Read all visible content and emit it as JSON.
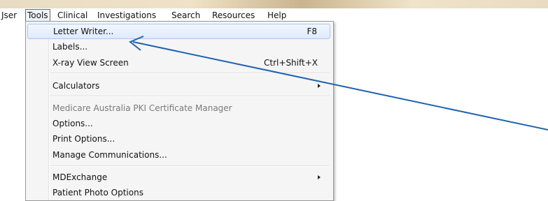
{
  "menubar": {
    "items": [
      {
        "label": "Jser"
      },
      {
        "label": "Tools"
      },
      {
        "label": "Clinical"
      },
      {
        "label": "Investigations"
      },
      {
        "label": "Search"
      },
      {
        "label": "Resources"
      },
      {
        "label": "Help"
      }
    ]
  },
  "tools_menu": {
    "items": [
      {
        "label": "Letter Writer...",
        "shortcut": "F8"
      },
      {
        "label": "Labels..."
      },
      {
        "label": "X-ray View Screen",
        "shortcut": "Ctrl+Shift+X"
      },
      {
        "label": "Calculators"
      },
      {
        "label": "Medicare Australia PKI Certificate Manager"
      },
      {
        "label": "Options..."
      },
      {
        "label": "Print Options..."
      },
      {
        "label": "Manage Communications..."
      },
      {
        "label": "MDExchange"
      },
      {
        "label": "Patient Photo Options"
      }
    ]
  },
  "annotation": {
    "color": "#1f63b0",
    "icon": "arrow-icon"
  }
}
